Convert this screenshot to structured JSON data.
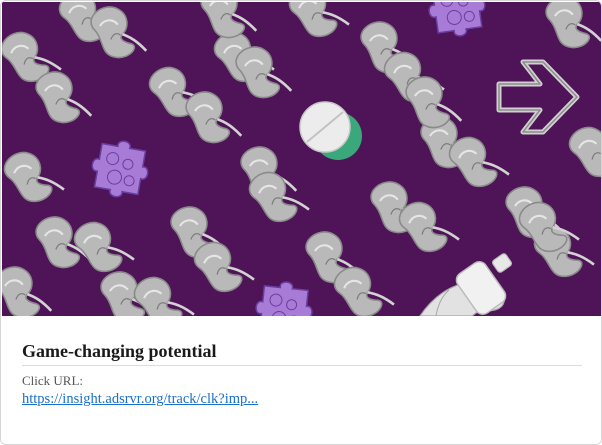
{
  "card": {
    "image_icons": [
      "kidney-icon",
      "puzzle-piece-icon",
      "pill-icon",
      "arrow-right-icon",
      "bottle-icon",
      "hand-icon"
    ],
    "colors": {
      "hero_background": "#4e1457",
      "kidney": "#b9b9b9",
      "puzzle": "#a77bd6",
      "pill_shadow": "#3aa87a",
      "link": "#1a6fc9"
    },
    "title": "Game-changing potential",
    "click_url_label": "Click URL:",
    "click_url": "https://insight.adsrvr.org/track/clk?imp..."
  }
}
